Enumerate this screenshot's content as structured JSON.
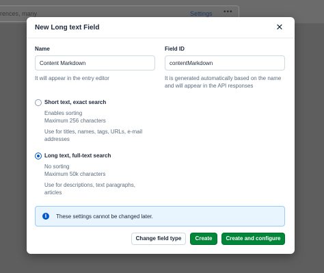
{
  "background": {
    "card_text": "rences, many",
    "settings_link": "Settings",
    "more_dots": "•••"
  },
  "modal": {
    "title": "New Long text Field",
    "close_icon": "✕",
    "name_label": "Name",
    "name_value": "Content Markdown",
    "name_help": "It will appear in the entry editor",
    "id_label": "Field ID",
    "id_value": "contentMarkdown",
    "id_help_1": "It is generated automatically based on the name",
    "id_help_2": "and will appear in the API responses",
    "options": [
      {
        "label": "Short text, exact search",
        "checked": false,
        "lines": [
          "Enables sorting",
          "Maximum 256 characters"
        ],
        "usage": [
          "Use for titles, names, tags, URLs, e-mail",
          "addresses"
        ]
      },
      {
        "label": "Long text, full-text search",
        "checked": true,
        "lines": [
          "No sorting",
          "Maximum 50k characters"
        ],
        "usage": [
          "Use for descriptions, text paragraphs,",
          "articles"
        ]
      }
    ],
    "note_icon": "i",
    "note_text": "These settings cannot be changed later.",
    "buttons": {
      "change_type": "Change field type",
      "create": "Create",
      "create_configure": "Create and configure"
    }
  }
}
